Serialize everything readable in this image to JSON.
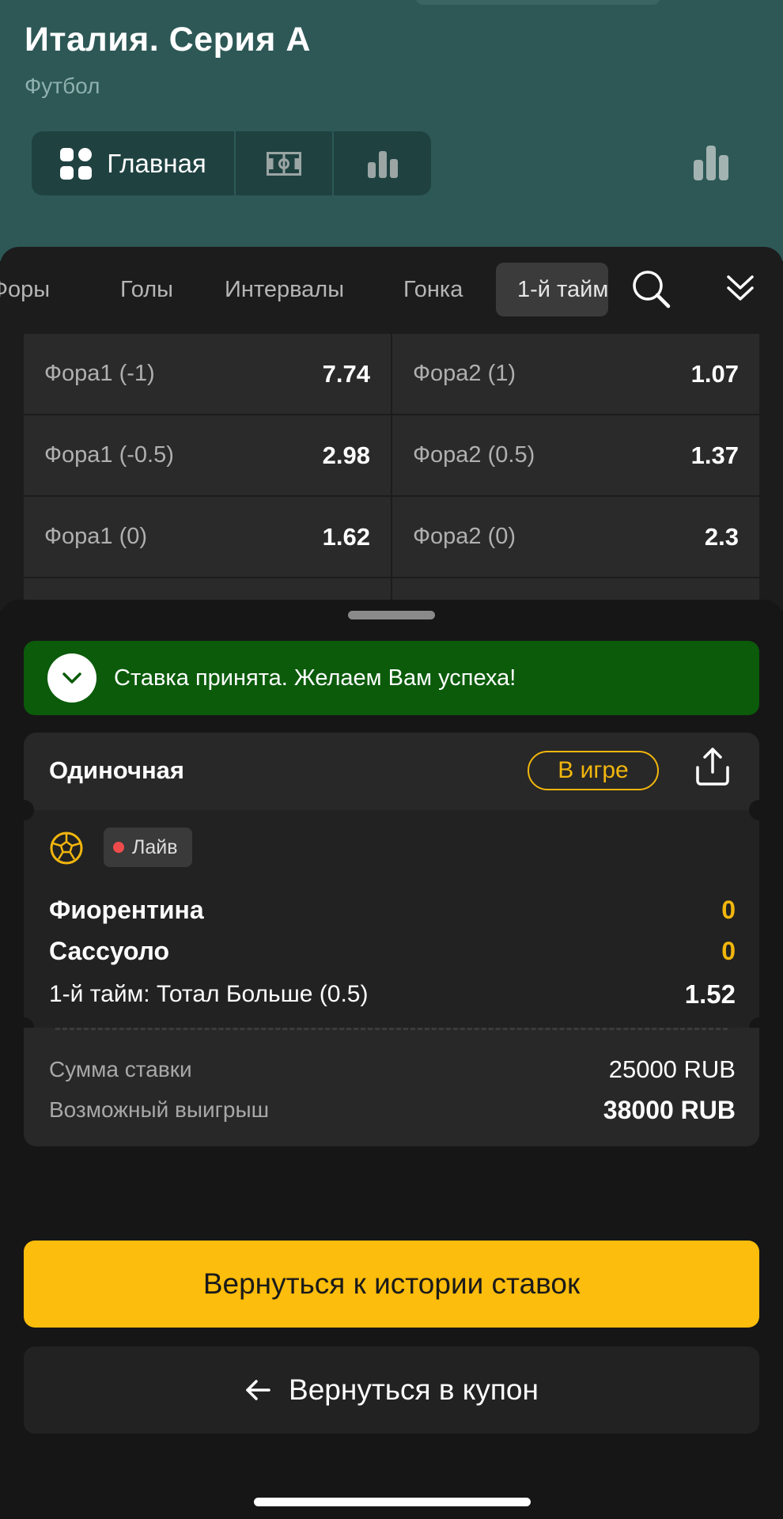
{
  "header": {
    "title": "Италия. Серия А",
    "subtitle": "Футбол",
    "segments": [
      {
        "label": "Главная",
        "icon": "dashboard-icon"
      },
      {
        "label": "",
        "icon": "field-icon"
      },
      {
        "label": "",
        "icon": "stats-icon"
      }
    ],
    "stats_icon": "stats-icon"
  },
  "market_tabs": [
    "Форы",
    "Голы",
    "Интервалы",
    "Гонка",
    "1-й тайм"
  ],
  "active_tab": "1-й тайм",
  "handicaps": [
    [
      {
        "label": "Фора1 (-1)",
        "odd": "7.74"
      },
      {
        "label": "Фора2 (1)",
        "odd": "1.07"
      }
    ],
    [
      {
        "label": "Фора1 (-0.5)",
        "odd": "2.98"
      },
      {
        "label": "Фора2 (0.5)",
        "odd": "1.37"
      }
    ],
    [
      {
        "label": "Фора1 (0)",
        "odd": "1.62"
      },
      {
        "label": "Фора2 (0)",
        "odd": "2.3"
      }
    ]
  ],
  "slip": {
    "success_message": "Ставка принята. Желаем Вам успеха!",
    "bet_type": "Одиночная",
    "status": "В игре",
    "live_label": "Лайв",
    "team1": "Фиорентина",
    "team2": "Сассуоло",
    "score1": "0",
    "score2": "0",
    "outcome": "1-й тайм: Тотал Больше (0.5)",
    "outcome_odd": "1.52",
    "stake_label": "Сумма ставки",
    "stake_value": "25000 RUB",
    "win_label": "Возможный выигрыш",
    "win_value": "38000 RUB",
    "history_button": "Вернуться к истории ставок",
    "coupon_button": "Вернуться в купон"
  },
  "colors": {
    "header_bg": "#2d5856",
    "accent": "#fdbd0c",
    "success": "#0b5b0b",
    "live_dot": "#ef4b4b"
  }
}
